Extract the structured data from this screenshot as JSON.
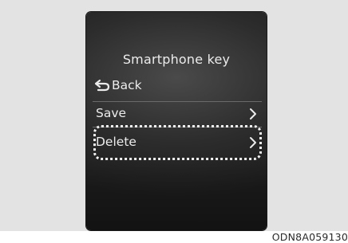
{
  "screen": {
    "title": "Smartphone key",
    "back_label": "Back",
    "items": [
      {
        "label": "Save"
      },
      {
        "label": "Delete"
      }
    ],
    "highlighted_item": "Delete"
  },
  "figure_code": "ODN8A059130",
  "colors": {
    "bezel": "#e3e3e3",
    "screen_bg": "#2c2c2c",
    "text": "#ececec",
    "highlight": "#f2f2f2"
  },
  "icons": {
    "back": "return-arrow-icon",
    "chevron": "chevron-right-icon"
  }
}
